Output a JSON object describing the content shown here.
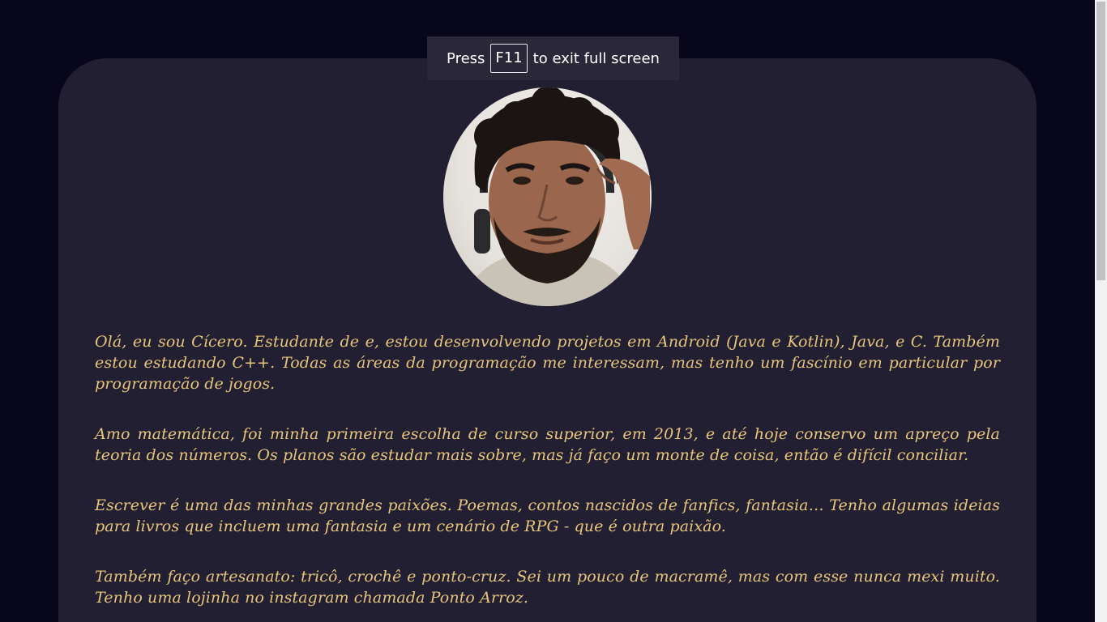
{
  "fullscreen_notice": {
    "prefix": "Press",
    "key": "F11",
    "suffix": "to exit full screen"
  },
  "profile": {
    "avatar_icon": "profile-photo"
  },
  "bio": {
    "paragraphs": [
      "Olá, eu sou Cícero. Estudante de e, estou desenvolvendo projetos em Android (Java e Kotlin), Java, e C. Também estou estudando C++. Todas as áreas da programação me interessam, mas tenho um fascínio em particular por programação de jogos.",
      "Amo matemática, foi minha primeira escolha de curso superior, em 2013, e até hoje conservo um apreço pela teoria dos números. Os planos são estudar mais sobre, mas já faço um monte de coisa, então é difícil conciliar.",
      "Escrever é uma das minhas grandes paixões. Poemas, contos nascidos de fanfics, fantasia… Tenho algumas ideias para livros que incluem uma fantasia e um cenário de RPG - que é outra paixão.",
      "Também faço artesanato: tricô, crochê e ponto-cruz. Sei um pouco de macramê, mas com esse nunca mexi muito. Tenho uma lojinha no instagram chamada Ponto Arroz."
    ]
  },
  "colors": {
    "page_background": "#07061a",
    "card_background": "#221f33",
    "text": "#e7c67b"
  }
}
